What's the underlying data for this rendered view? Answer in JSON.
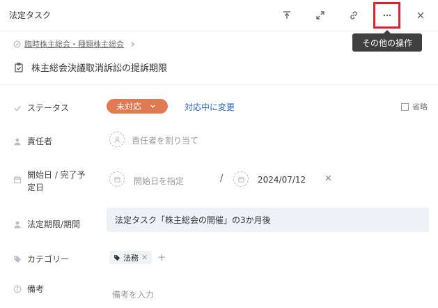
{
  "header": {
    "title": "法定タスク",
    "icons": [
      "move-to-top-icon",
      "expand-icon",
      "link-icon",
      "more-icon",
      "close-icon"
    ],
    "tooltip": "その他の操作"
  },
  "breadcrumb": {
    "parent": "臨時株主総会・種類株主総会"
  },
  "task": {
    "title": "株主総会決議取消訴訟の提訴期限"
  },
  "fields": {
    "status": {
      "label": "ステータス",
      "value": "未対応",
      "action": "対応中に変更",
      "omit": "省略",
      "color": "#e07a52"
    },
    "assignee": {
      "label": "責任者",
      "placeholder": "責任者を割り当て"
    },
    "dates": {
      "label_line1": "開始日 / 完了予",
      "label_line2": "定日",
      "start_placeholder": "開始日を指定",
      "separator": "/",
      "due": "2024/07/12"
    },
    "deadline": {
      "label": "法定期限/期間",
      "value": "法定タスク「株主総会の開催」の3か月後"
    },
    "category": {
      "label": "カテゴリー",
      "tag": "法務"
    },
    "notes": {
      "label": "備考",
      "placeholder": "備考を入力"
    }
  },
  "colors": {
    "accent_link": "#2166c4",
    "highlight": "#e0202a"
  }
}
